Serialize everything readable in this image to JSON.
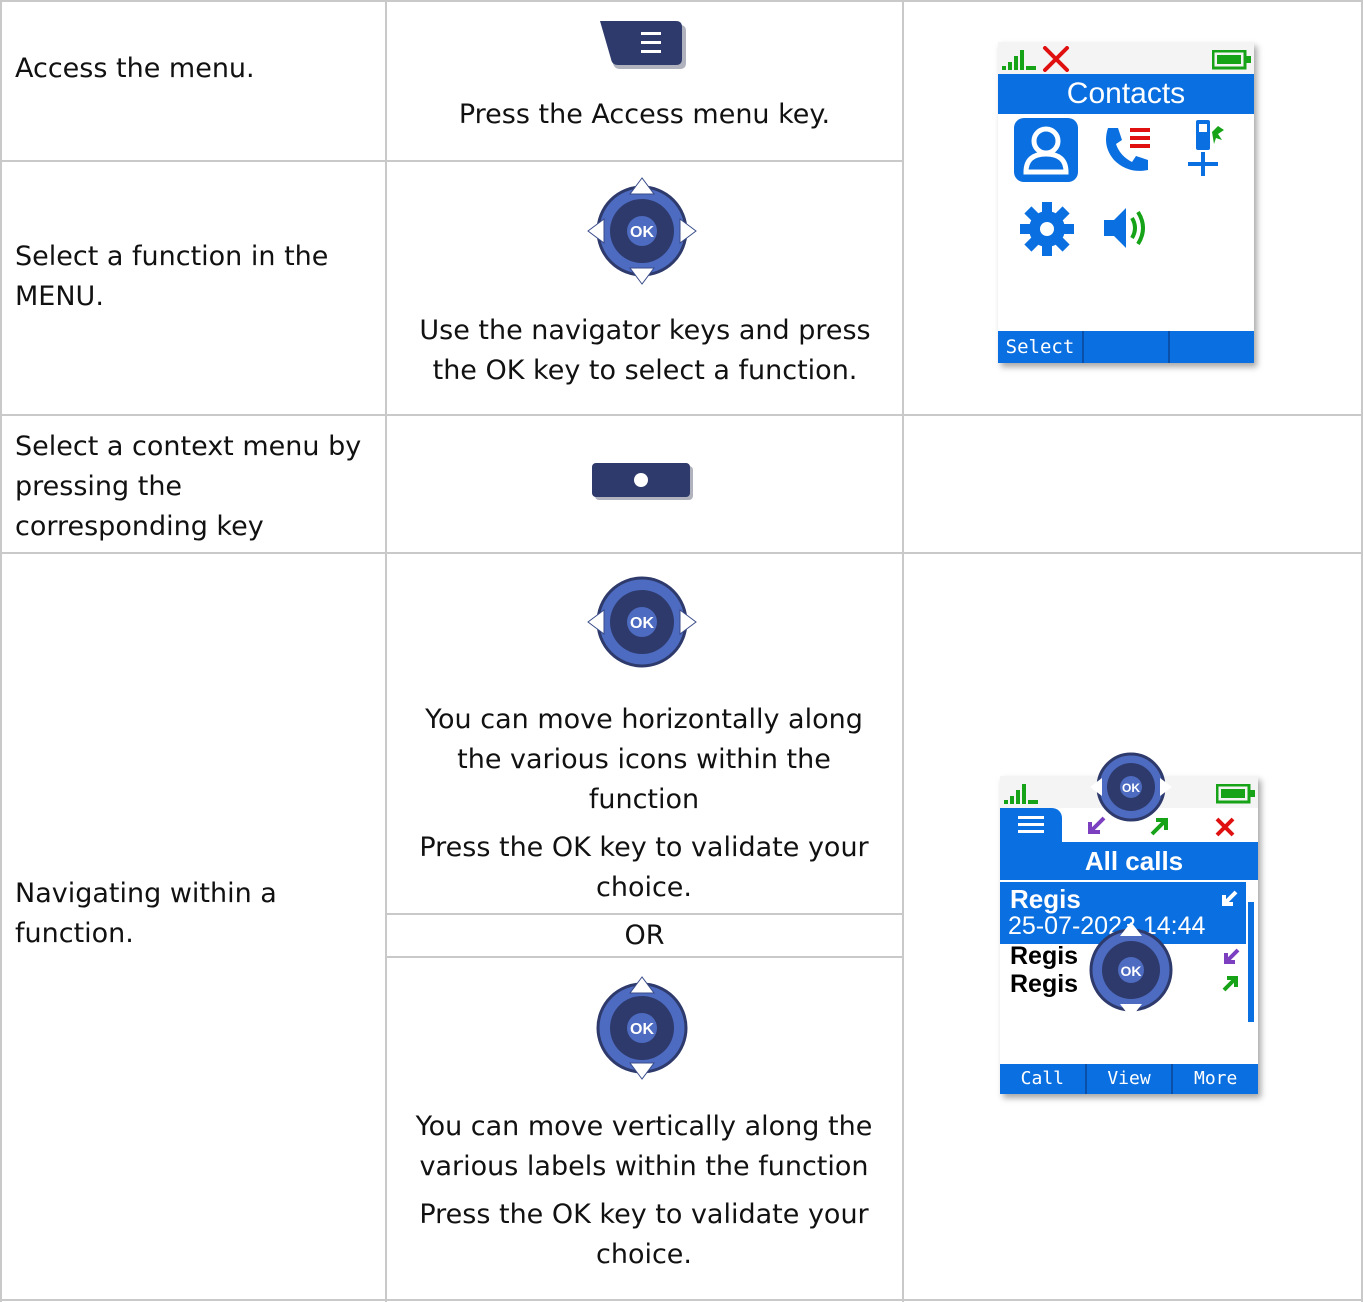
{
  "rows": [
    {
      "action": "Access the menu.",
      "instruction": "Press the Access menu key."
    },
    {
      "action": "Select a function in the MENU.",
      "instruction": "Use the navigator keys and press the OK key to select a function."
    },
    {
      "action": "Select a context menu by pressing the corresponding key"
    },
    {
      "action": "Navigating within a function.",
      "horizontal_text": "You can move horizontally along the various icons within the function",
      "horizontal_validate": "Press the OK key to validate your choice.",
      "or_label": "OR",
      "vertical_text": "You can move vertically along the various labels within the function",
      "vertical_validate": "Press the OK key to validate your choice."
    }
  ],
  "nav_key_label": "OK",
  "screen1": {
    "title": "Contacts",
    "softkeys": [
      "Select",
      "",
      ""
    ],
    "icons": [
      "contacts-icon",
      "call-log-icon",
      "handset-settings-icon",
      "settings-gear-icon",
      "volume-icon"
    ]
  },
  "screen2": {
    "title": "All calls",
    "entry_name": "Regis",
    "entry_datetime": "25-07-2023 14:44",
    "list": [
      "Regis",
      "Regis"
    ],
    "softkeys": [
      "Call",
      "View",
      "More"
    ]
  },
  "colors": {
    "screen_blue": "#0a6fe0",
    "key_navy": "#2e3a6b",
    "nav_blue": "#4d6bc0",
    "signal_green": "#17a317",
    "alert_red": "#e01010"
  }
}
